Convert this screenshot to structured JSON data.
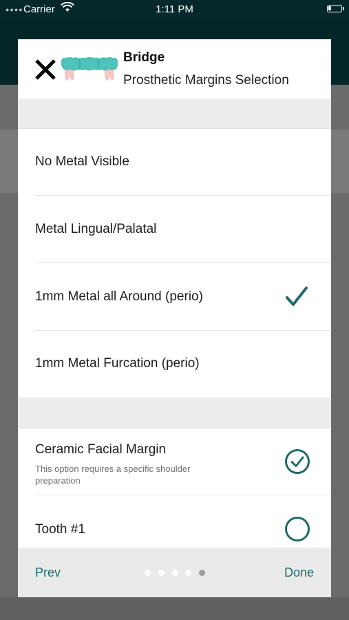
{
  "status_bar": {
    "carrier": "Carrier",
    "time": "1:11 PM"
  },
  "header": {
    "title": "Bridge",
    "subtitle": "Prosthetic Margins Selection"
  },
  "options_group_1": [
    {
      "label": "No Metal Visible",
      "selected": false
    },
    {
      "label": "Metal Lingual/Palatal",
      "selected": false
    },
    {
      "label": "1mm Metal all Around (perio)",
      "selected": true
    },
    {
      "label": "1mm Metal Furcation (perio)",
      "selected": false
    }
  ],
  "options_group_2": [
    {
      "label": "Ceramic Facial Margin",
      "helper": "This option requires a specific shoulder preparation",
      "checked": true
    },
    {
      "label": "Tooth #1",
      "checked": false
    }
  ],
  "footer": {
    "prev_label": "Prev",
    "done_label": "Done",
    "page_count": 5,
    "current_page": 5
  },
  "colors": {
    "accent": "#1f6a6a",
    "tooth": "#4ec3b9",
    "gum": "#f4c6c4",
    "status_bar_bg": "#05282a"
  }
}
